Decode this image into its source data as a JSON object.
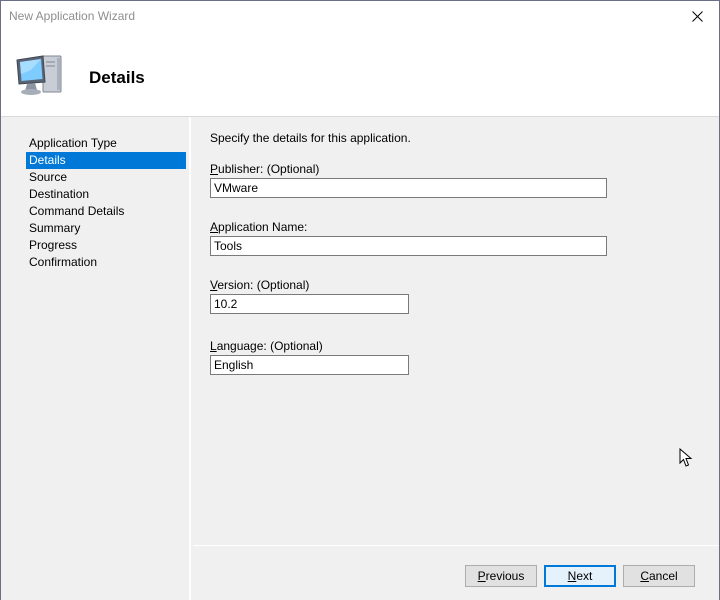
{
  "window": {
    "title": "New Application Wizard"
  },
  "header": {
    "title": "Details",
    "icon": "computer-icon"
  },
  "nav": {
    "items": [
      {
        "label": "Application Type",
        "selected": false
      },
      {
        "label": "Details",
        "selected": true
      },
      {
        "label": "Source",
        "selected": false
      },
      {
        "label": "Destination",
        "selected": false
      },
      {
        "label": "Command Details",
        "selected": false
      },
      {
        "label": "Summary",
        "selected": false
      },
      {
        "label": "Progress",
        "selected": false
      },
      {
        "label": "Confirmation",
        "selected": false
      }
    ]
  },
  "main": {
    "intro": "Specify the details for this application.",
    "publisher": {
      "label_first": "P",
      "label_rest": "ublisher: (Optional)",
      "value": "VMware"
    },
    "app_name": {
      "label_first": "A",
      "label_rest": "pplication Name:",
      "value": "Tools"
    },
    "version": {
      "label_first": "V",
      "label_rest": "ersion: (Optional)",
      "value": "10.2"
    },
    "language": {
      "label_first": "L",
      "label_rest": "anguage: (Optional)",
      "value": "English"
    }
  },
  "buttons": {
    "previous": {
      "first": "P",
      "rest": "revious"
    },
    "next": {
      "first": "N",
      "rest": "ext"
    },
    "cancel": {
      "first": "C",
      "rest": "ancel"
    }
  },
  "colors": {
    "selection": "#0078d7",
    "panel": "#f0f0f0",
    "title_text": "#8e8e8e"
  }
}
